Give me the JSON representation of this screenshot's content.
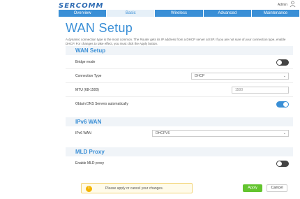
{
  "header": {
    "logo": "SERCOMM",
    "user": "Admin"
  },
  "tabs": [
    {
      "label": "Overview"
    },
    {
      "label": "Basic"
    },
    {
      "label": "Wireless"
    },
    {
      "label": "Advanced"
    },
    {
      "label": "Maintenance"
    }
  ],
  "page": {
    "title": "WAN Setup",
    "description": "A dynamic connection type is the most common. The Router gets its IP address from a DHCP server at ISP. If you are not sure of your connection type, enable DHCP. For changes to take effect, you must click the Apply button."
  },
  "wan_setup": {
    "heading": "WAN Setup",
    "bridge_mode_label": "Bridge mode",
    "bridge_mode_enabled": false,
    "connection_type_label": "Connection Type",
    "connection_type_value": "DHCP",
    "mtu_label": "MTU (68-1500)",
    "mtu_value": "1500",
    "dns_label": "Obtain DNS Servers automatically",
    "dns_enabled": true
  },
  "ipv6_wan": {
    "heading": "IPv6 WAN",
    "label": "IPv6 WAN",
    "value": "DHCPV6"
  },
  "mld_proxy": {
    "heading": "MLD Proxy",
    "label": "Enable MLD proxy",
    "enabled": false
  },
  "footer": {
    "notice": "Please apply or cancel your changes.",
    "apply_label": "Apply",
    "cancel_label": "Cancel"
  },
  "colors": {
    "accent": "#3a8fd6",
    "apply": "#63c42f",
    "notice_icon": "#f4b400"
  }
}
